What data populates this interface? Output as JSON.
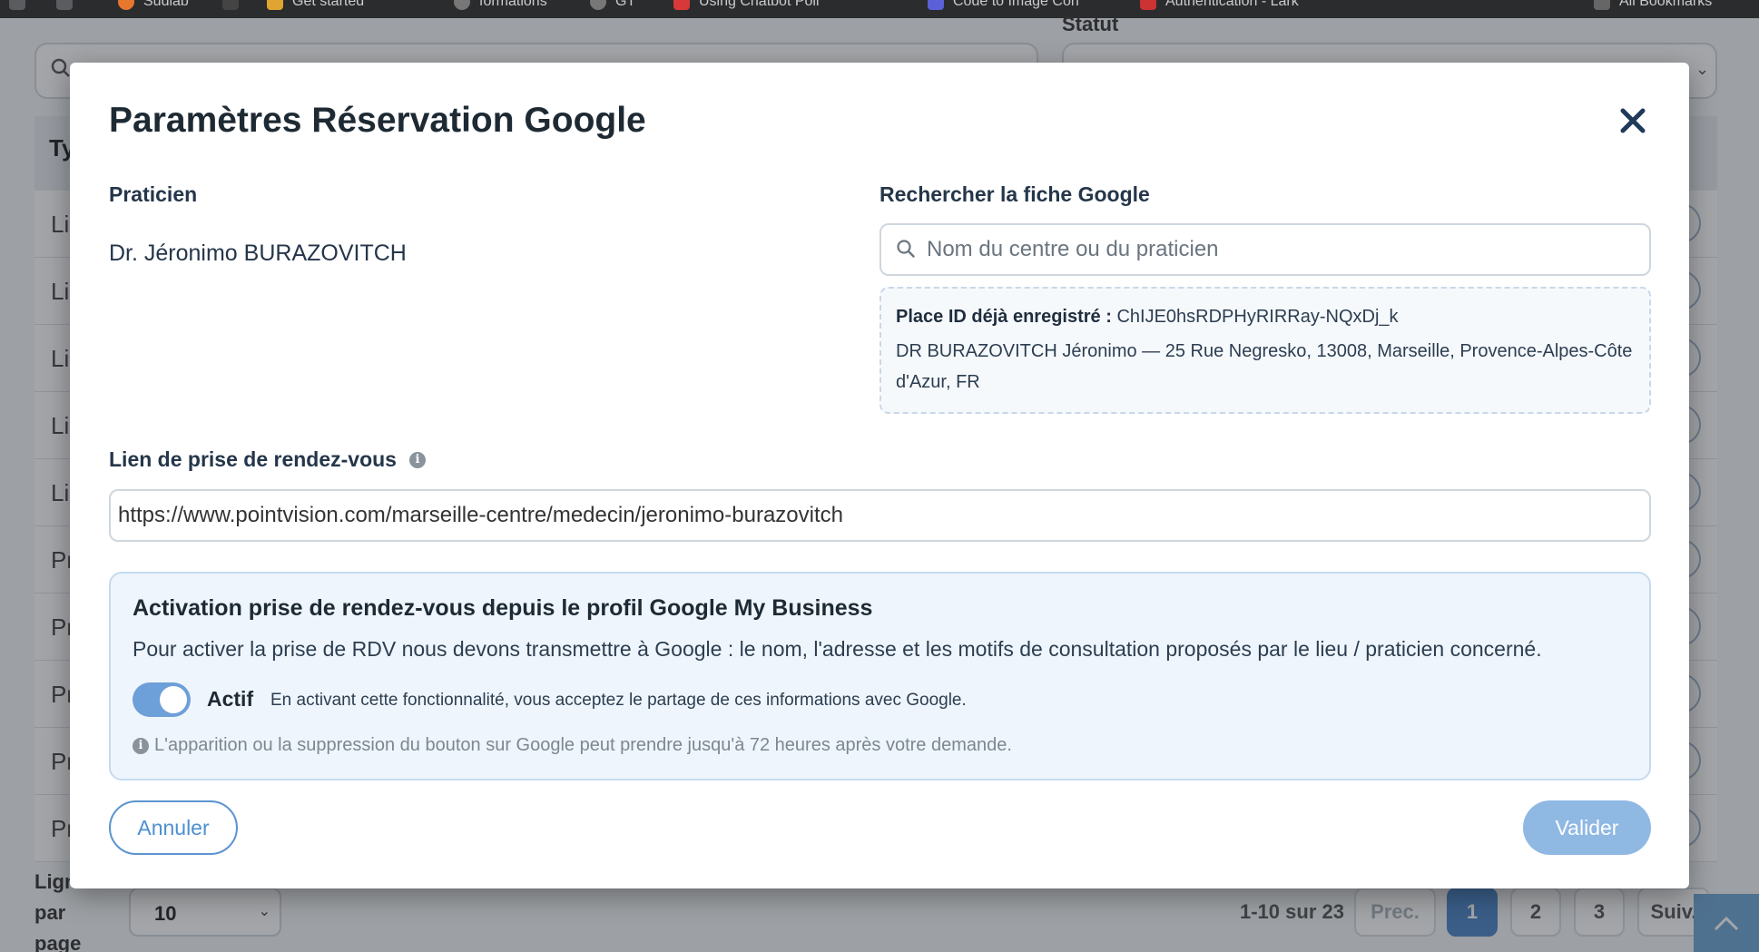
{
  "browser": {
    "bookmarks": [
      "Sudlab",
      "Get started",
      "formations",
      "GT",
      "Using Chatbot Poll",
      "Code to Image Con",
      "Authentication - Lark",
      "All Bookmarks"
    ]
  },
  "background": {
    "statut_label": "Statut",
    "table_header_first": "Ty",
    "rows": [
      "Li",
      "Li",
      "Li",
      "Li",
      "Li",
      "Pr",
      "Pr",
      "Pr",
      "Pr",
      "Pr"
    ],
    "rows_per_page_label": [
      "Lign",
      "par",
      "page"
    ],
    "rows_per_page_value": "10",
    "pagination": {
      "count": "1-10 sur 23",
      "prev": "Prec.",
      "pages": [
        "1",
        "2",
        "3"
      ],
      "next": "Suiv.",
      "active_page": "1"
    }
  },
  "modal": {
    "title": "Paramètres Réservation Google",
    "praticien_label": "Praticien",
    "praticien_name": "Dr. Jéronimo BURAZOVITCH",
    "search_label": "Rechercher la fiche Google",
    "search_placeholder": "Nom du centre ou du praticien",
    "place": {
      "label": "Place ID déjà enregistré :",
      "id": "ChIJE0hsRDPHyRIRRay-NQxDj_k",
      "address": "DR BURAZOVITCH Jéronimo — 25 Rue Negresko, 13008, Marseille, Provence-Alpes-Côte d'Azur, FR"
    },
    "link_label": "Lien de prise de rendez-vous",
    "link_value": "https://www.pointvision.com/marseille-centre/medecin/jeronimo-burazovitch",
    "activation": {
      "title": "Activation prise de rendez-vous depuis le profil Google My Business",
      "description": "Pour activer la prise de RDV nous devons transmettre à Google : le nom, l'adresse et les motifs de consultation proposés par le lieu / praticien concerné.",
      "toggle_on": true,
      "state_label": "Actif",
      "consent": "En activant cette fonctionnalité, vous acceptez le partage de ces informations avec Google.",
      "note": "L'apparition ou la suppression du bouton sur Google peut prendre jusqu'à 72 heures après votre demande."
    },
    "cancel_label": "Annuler",
    "submit_label": "Valider"
  },
  "colors": {
    "accent": "#4e8fd1",
    "toggle_on": "#6d9fd8",
    "submit_bg": "#8fb8e3",
    "activation_bg": "#eef5fd"
  }
}
